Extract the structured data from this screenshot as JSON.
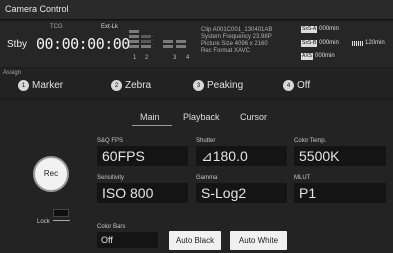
{
  "app": {
    "title": "Camera Control"
  },
  "status": {
    "state": "Stby",
    "tcg_label": "TCG",
    "extlk_label": "Ext-Lk",
    "timecode": "00:00:00:00",
    "meter_channels": [
      "1",
      "2",
      "3",
      "4"
    ],
    "clip": "Clip A001C001_130401AB",
    "system_frequency": "System Frequency 23.98P",
    "picture_size": "Picture Size 4096 x 2160",
    "rec_format": "Rec Format XAVC",
    "media": [
      {
        "slot": "SxS-A",
        "value": "000min"
      },
      {
        "slot": "SxS-B",
        "value": "000min"
      },
      {
        "slot": "AXS",
        "value": "000min"
      }
    ],
    "battery": "120min"
  },
  "assign": {
    "label": "Assign",
    "items": [
      {
        "num": "1",
        "label": "Marker"
      },
      {
        "num": "2",
        "label": "Zebra"
      },
      {
        "num": "3",
        "label": "Peaking"
      },
      {
        "num": "4",
        "label": "Off"
      }
    ]
  },
  "tabs": {
    "main": "Main",
    "playback": "Playback",
    "cursor": "Cursor"
  },
  "params": {
    "sq_fps": {
      "label": "S&Q FPS",
      "value": "60FPS"
    },
    "shutter": {
      "label": "Shutter",
      "value": "⊿180.0"
    },
    "color_temp": {
      "label": "Color Temp.",
      "value": "5500K"
    },
    "sensitivity": {
      "label": "Sensitivity",
      "value": "ISO 800"
    },
    "gamma": {
      "label": "Gamma",
      "value": "S-Log2"
    },
    "mlut": {
      "label": "MLUT",
      "value": "P1"
    },
    "color_bars": {
      "label": "Color Bars",
      "value": "Off"
    }
  },
  "controls": {
    "rec": "Rec",
    "lock": "Lock",
    "auto_black": "Auto Black",
    "auto_white": "Auto White"
  }
}
